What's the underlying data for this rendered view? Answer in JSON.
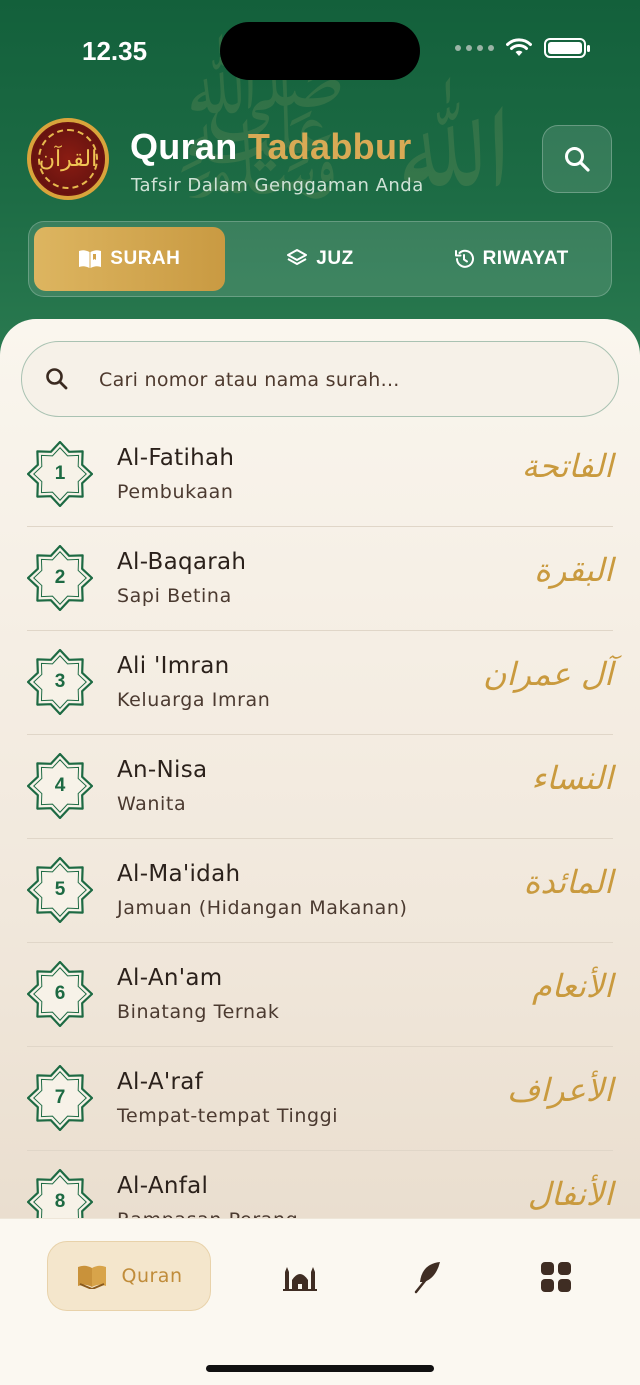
{
  "status_bar": {
    "time": "12.35"
  },
  "header": {
    "title_main": "Quran",
    "title_accent": "Tadabbur",
    "subtitle": "Tafsir Dalam Genggaman Anda",
    "logo_text": "القرآن"
  },
  "tabs": [
    {
      "label": "SURAH",
      "icon": "book-icon",
      "active": true
    },
    {
      "label": "JUZ",
      "icon": "layers-icon",
      "active": false
    },
    {
      "label": "RIWAYAT",
      "icon": "history-icon",
      "active": false
    }
  ],
  "search": {
    "placeholder": "Cari nomor atau nama surah..."
  },
  "surahs": [
    {
      "number": "1",
      "name": "Al-Fatihah",
      "meaning": "Pembukaan",
      "arabic": "الفاتحة"
    },
    {
      "number": "2",
      "name": "Al-Baqarah",
      "meaning": "Sapi Betina",
      "arabic": "البقرة"
    },
    {
      "number": "3",
      "name": "Ali 'Imran",
      "meaning": "Keluarga Imran",
      "arabic": "آل عمران"
    },
    {
      "number": "4",
      "name": "An-Nisa",
      "meaning": "Wanita",
      "arabic": "النساء"
    },
    {
      "number": "5",
      "name": "Al-Ma'idah",
      "meaning": "Jamuan (Hidangan Makanan)",
      "arabic": "المائدة"
    },
    {
      "number": "6",
      "name": "Al-An'am",
      "meaning": "Binatang Ternak",
      "arabic": "الأنعام"
    },
    {
      "number": "7",
      "name": "Al-A'raf",
      "meaning": "Tempat-tempat Tinggi",
      "arabic": "الأعراف"
    },
    {
      "number": "8",
      "name": "Al-Anfal",
      "meaning": "Rampasan Perang",
      "arabic": "الأنفال"
    }
  ],
  "bottom_nav": {
    "quran_label": "Quran",
    "items": [
      "quran-icon",
      "mosque-icon",
      "feather-icon",
      "grid-icon"
    ]
  },
  "colors": {
    "header_green": "#1d6c45",
    "gold_accent": "#d9aa55",
    "badge_green": "#1d6a43",
    "arabic_gold": "#c99a3e"
  }
}
